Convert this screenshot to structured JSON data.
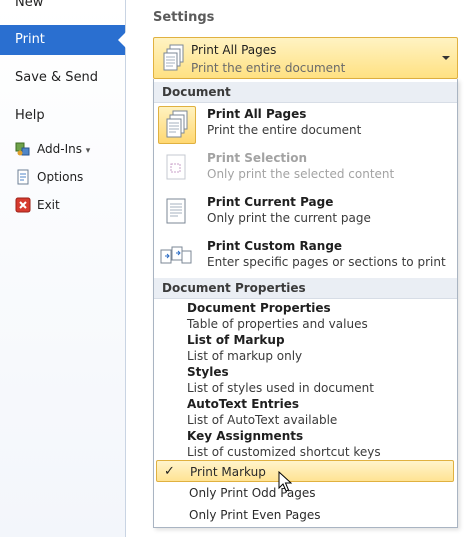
{
  "nav": {
    "new_label": "New",
    "print_label": "Print",
    "save_send_label": "Save & Send",
    "help_label": "Help",
    "addins_label": "Add-Ins",
    "options_label": "Options",
    "exit_label": "Exit"
  },
  "settings": {
    "heading": "Settings",
    "dropdown": {
      "title": "Print All Pages",
      "description": "Print the entire document"
    }
  },
  "menu": {
    "document_header": "Document",
    "document_items": [
      {
        "title": "Print All Pages",
        "description": "Print the entire document",
        "state": "selected"
      },
      {
        "title": "Print Selection",
        "description": "Only print the selected content",
        "state": "disabled"
      },
      {
        "title": "Print Current Page",
        "description": "Only print the current page",
        "state": "normal"
      },
      {
        "title": "Print Custom Range",
        "description": "Enter specific pages or sections to print",
        "state": "normal"
      }
    ],
    "properties_header": "Document Properties",
    "property_items": [
      {
        "title": "Document Properties",
        "description": "Table of properties and values"
      },
      {
        "title": "List of Markup",
        "description": "List of markup only"
      },
      {
        "title": "Styles",
        "description": "List of styles used in document"
      },
      {
        "title": "AutoText Entries",
        "description": "List of AutoText available"
      },
      {
        "title": "Key Assignments",
        "description": "List of customized shortcut keys"
      }
    ],
    "options": [
      {
        "label": "Print Markup",
        "checked": true,
        "check_glyph": "✓"
      },
      {
        "label": "Only Print Odd Pages",
        "checked": false
      },
      {
        "label": "Only Print Even Pages",
        "checked": false
      }
    ]
  },
  "colors": {
    "nav_selected": "#2a6fd0",
    "highlight_fill": "#ffe393",
    "highlight_border": "#e0b140"
  }
}
